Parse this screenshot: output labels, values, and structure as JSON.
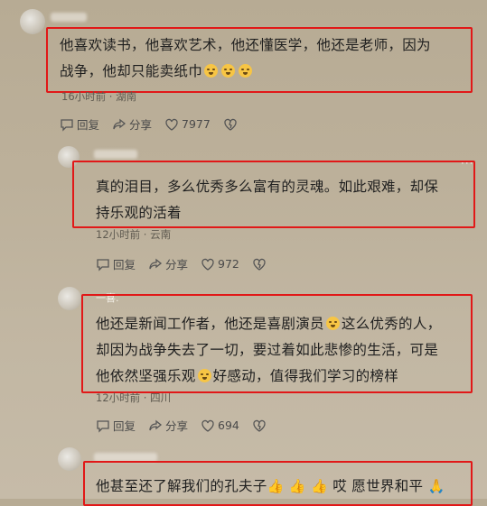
{
  "comments": [
    {
      "line1": "他喜欢读书，他喜欢艺术，他还懂医学，他还是老师，因为",
      "line2": "战争，他却只能卖纸巾",
      "meta": "16小时前 · 湖南",
      "reply": "回复",
      "share": "分享",
      "likes": "7977"
    },
    {
      "line1": "真的泪目，多么优秀多么富有的灵魂。如此艰难，却保",
      "line2": "持乐观的活着",
      "meta": "12小时前 · 云南",
      "reply": "回复",
      "share": "分享",
      "likes": "972"
    },
    {
      "name": "一喜.",
      "line1": "他还是新闻工作者，他还是喜剧演员",
      "line1b": "这么优秀的人，",
      "line2": "却因为战争失去了一切，要过着如此悲惨的生活，可是",
      "line3a": "他依然坚强乐观",
      "line3b": "好感动，值得我们学习的榜样",
      "meta": "12小时前 · 四川",
      "reply": "回复",
      "share": "分享",
      "likes": "694"
    },
    {
      "text_a": "他甚至还了解我们的孔夫子",
      "text_b": "哎 愿世界和平"
    }
  ],
  "icons": [
    "reply-icon",
    "share-icon",
    "heart-icon",
    "dislike-heart-icon",
    "crying-emoji-icon",
    "thumbs-up-icon",
    "pray-icon"
  ],
  "highlight_color": "#e11818"
}
